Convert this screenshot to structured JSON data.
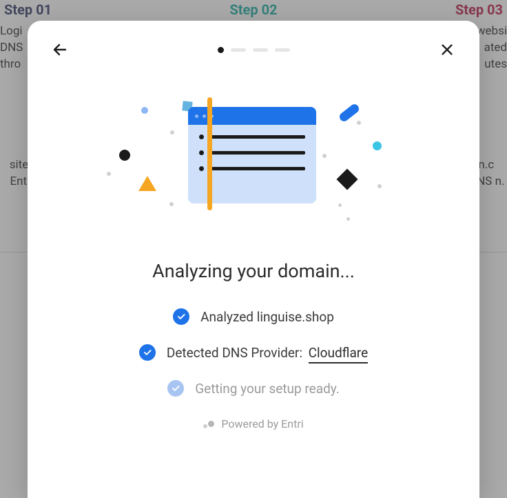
{
  "background": {
    "step1": "Step 01",
    "step2": "Step 02",
    "step3": "Step 03",
    "left_top": "Logi\nDNS\nthro",
    "right_top": "websi\nated\nutes",
    "left_mid": "site\ng Ent\nO",
    "right_mid": "ain.c\nDNS\nn."
  },
  "modal": {
    "title": "Analyzing your domain...",
    "checks": {
      "analyzed": "Analyzed linguise.shop",
      "detected_prefix": "Detected DNS Provider:",
      "provider": "Cloudflare",
      "pending": "Getting your setup ready."
    },
    "footer": "Powered by Entri"
  }
}
